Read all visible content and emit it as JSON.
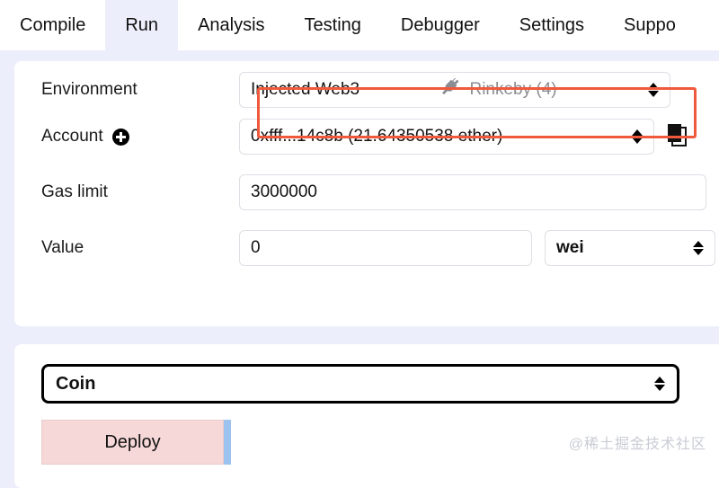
{
  "tabs": [
    {
      "label": "Compile",
      "active": false
    },
    {
      "label": "Run",
      "active": true
    },
    {
      "label": "Analysis",
      "active": false
    },
    {
      "label": "Testing",
      "active": false
    },
    {
      "label": "Debugger",
      "active": false
    },
    {
      "label": "Settings",
      "active": false
    },
    {
      "label": "Suppo",
      "active": false
    }
  ],
  "settings": {
    "environment": {
      "label": "Environment",
      "value": "Injected Web3",
      "network": "Rinkeby (4)",
      "icon": "plug-icon",
      "highlight_color": "#f05a3c"
    },
    "account": {
      "label": "Account",
      "add_icon": "plus-circle-icon",
      "value": "0xfff...14c8b (21.64350538 ether)",
      "copy_icon": "copy-icon"
    },
    "gas_limit": {
      "label": "Gas limit",
      "value": "3000000"
    },
    "value": {
      "label": "Value",
      "value": "0",
      "unit": "wei"
    }
  },
  "contract": {
    "selected": "Coin",
    "deploy_label": "Deploy",
    "deploy_args_value": ""
  },
  "watermark": "@稀土掘金技术社区"
}
